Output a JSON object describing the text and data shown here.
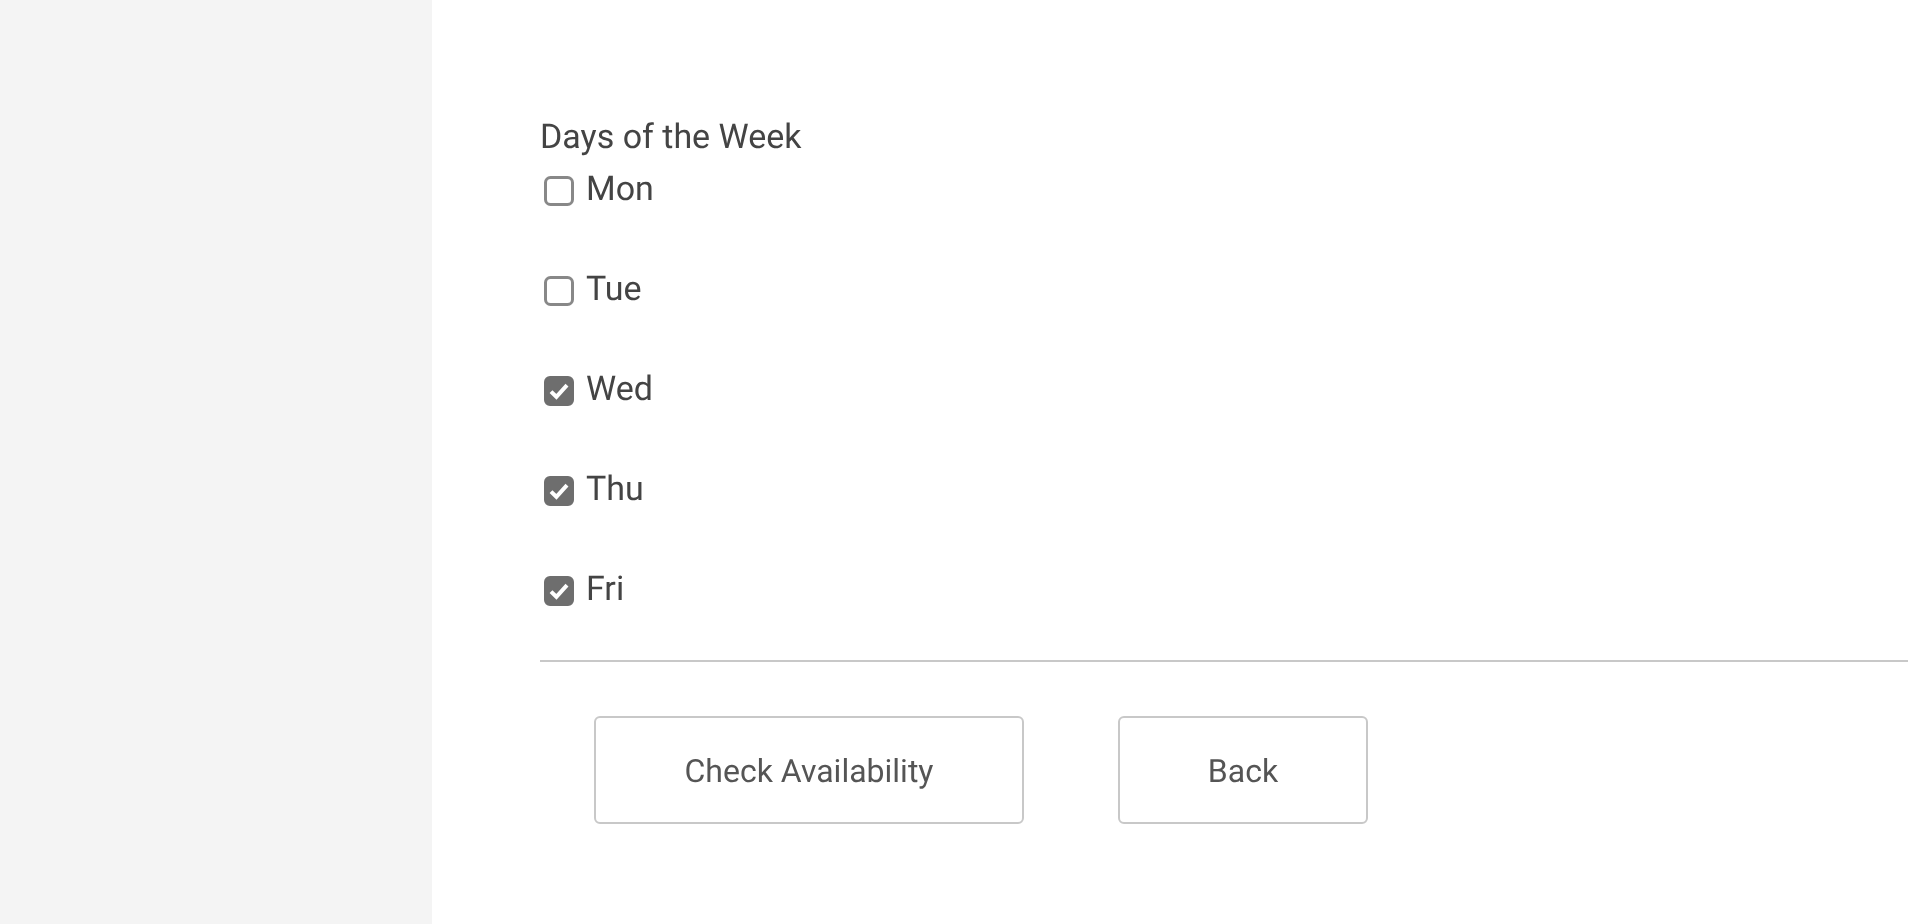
{
  "section_title": "Days of the Week",
  "days": [
    {
      "label": "Mon",
      "checked": false
    },
    {
      "label": "Tue",
      "checked": false
    },
    {
      "label": "Wed",
      "checked": true
    },
    {
      "label": "Thu",
      "checked": true
    },
    {
      "label": "Fri",
      "checked": true
    }
  ],
  "buttons": [
    "Check Availability",
    "Back"
  ]
}
